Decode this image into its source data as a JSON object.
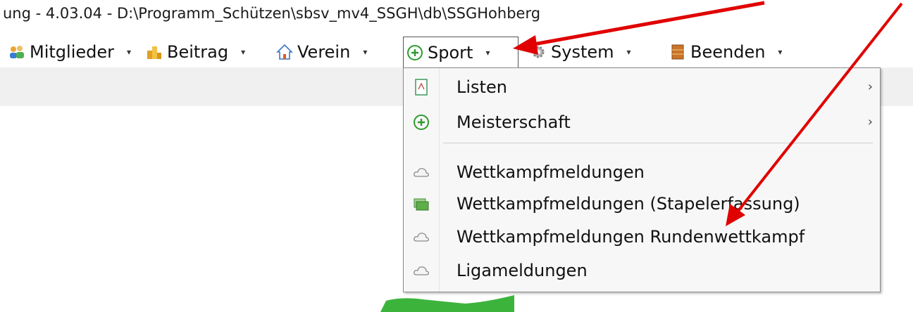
{
  "window": {
    "title": "ung - 4.03.04 - D:\\Programm_Schützen\\sbsv_mv4_SSGH\\db\\SSGHohberg"
  },
  "menubar": {
    "items": [
      {
        "label": "Mitglieder",
        "icon": "members-icon"
      },
      {
        "label": "Beitrag",
        "icon": "coins-icon"
      },
      {
        "label": "Verein",
        "icon": "house-icon"
      },
      {
        "label": "Sport",
        "icon": "plus-circle-icon",
        "open": true
      },
      {
        "label": "System",
        "icon": "gear-icon"
      },
      {
        "label": "Beenden",
        "icon": "door-icon"
      }
    ],
    "dropdown_arrow": "▾"
  },
  "sport_menu": {
    "items": [
      {
        "label": "Listen",
        "icon": "document-icon",
        "submenu": true
      },
      {
        "label": "Meisterschaft",
        "icon": "plus-circle-icon",
        "submenu": true
      },
      {
        "label": "Wettkampfmeldungen",
        "icon": "cloud-icon",
        "submenu": false
      },
      {
        "label": "Wettkampfmeldungen (Stapelerfassung)",
        "icon": "folders-icon",
        "submenu": false
      },
      {
        "label": "Wettkampfmeldungen Rundenwettkampf",
        "icon": "cloud-icon",
        "submenu": false
      },
      {
        "label": "Ligameldungen",
        "icon": "cloud-icon",
        "submenu": false
      }
    ],
    "submenu_glyph": "›"
  },
  "colors": {
    "annotation_arrow": "#e00000",
    "sport_icon_green": "#2e9b2e",
    "menu_background": "#f7f7f7",
    "strip_background": "#f0f0f0"
  }
}
